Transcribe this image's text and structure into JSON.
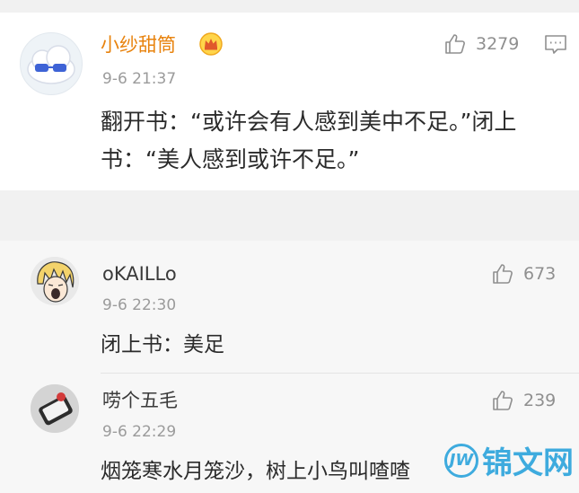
{
  "comment": {
    "username": "小纱甜筒",
    "badge_icon": "crown-icon",
    "time": "9-6 21:37",
    "likes": "3279",
    "text": "翻开书：“或许会有人感到美中不足。”闭上书：“美人感到或许不足。”",
    "name_color": "#e8830e"
  },
  "replies": [
    {
      "username": "oKAILLo",
      "time": "9-6 22:30",
      "likes": "673",
      "text": "闭上书：美足"
    },
    {
      "username": "唠个五毛",
      "time": "9-6 22:29",
      "likes": "239",
      "text": "烟笼寒水月笼沙，树上小鸟叫喳喳"
    }
  ],
  "watermark": {
    "logo_text": "JW",
    "text": "锦文网"
  }
}
